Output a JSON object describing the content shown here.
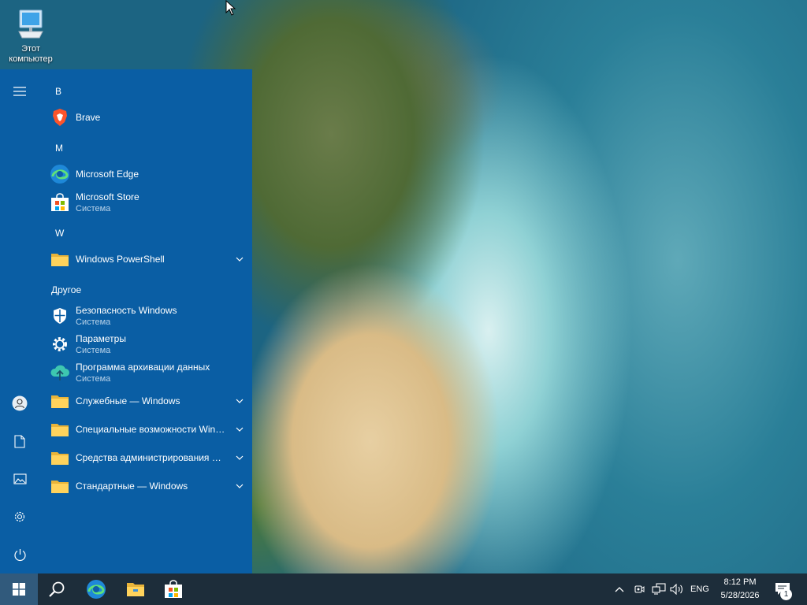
{
  "desktop": {
    "icon_label": "Этот компьютер"
  },
  "start_menu": {
    "sections": [
      {
        "header": "B",
        "items": [
          {
            "icon": "brave-icon",
            "label": "Brave",
            "subtitle": "",
            "expandable": false
          }
        ]
      },
      {
        "header": "M",
        "items": [
          {
            "icon": "edge-icon",
            "label": "Microsoft Edge",
            "subtitle": "",
            "expandable": false
          },
          {
            "icon": "store-icon",
            "label": "Microsoft Store",
            "subtitle": "Система",
            "expandable": false
          }
        ]
      },
      {
        "header": "W",
        "items": [
          {
            "icon": "folder-icon",
            "label": "Windows PowerShell",
            "subtitle": "",
            "expandable": true
          }
        ]
      },
      {
        "header": "Другое",
        "items": [
          {
            "icon": "shield-icon",
            "label": "Безопасность Windows",
            "subtitle": "Система",
            "expandable": false
          },
          {
            "icon": "gear-icon",
            "label": "Параметры",
            "subtitle": "Система",
            "expandable": false
          },
          {
            "icon": "backup-icon",
            "label": "Программа архивации данных",
            "subtitle": "Система",
            "expandable": false
          },
          {
            "icon": "folder-icon",
            "label": "Служебные — Windows",
            "subtitle": "",
            "expandable": true
          },
          {
            "icon": "folder-icon",
            "label": "Специальные возможности Windows",
            "subtitle": "",
            "expandable": true
          },
          {
            "icon": "folder-icon",
            "label": "Средства администрирования Windows",
            "subtitle": "",
            "expandable": true
          },
          {
            "icon": "folder-icon",
            "label": "Стандартные — Windows",
            "subtitle": "",
            "expandable": true
          }
        ]
      }
    ],
    "rail": [
      "hamburger-icon",
      "user-icon",
      "document-icon",
      "pictures-icon",
      "settings-icon",
      "power-icon"
    ]
  },
  "taskbar": {
    "pinned": [
      "start-icon",
      "search-icon",
      "edge-icon",
      "file-explorer-icon",
      "store-icon"
    ],
    "tray_icons": [
      "chevron-up-icon",
      "meet-now-icon",
      "network-icon",
      "volume-icon"
    ],
    "language": "ENG",
    "time": "8:12 PM",
    "date": "5/28/2026",
    "notification_count": "1"
  },
  "colors": {
    "start_menu_bg": "#0a5ea4",
    "taskbar_bg": "#1d2d3a",
    "accent": "#0078d7"
  }
}
